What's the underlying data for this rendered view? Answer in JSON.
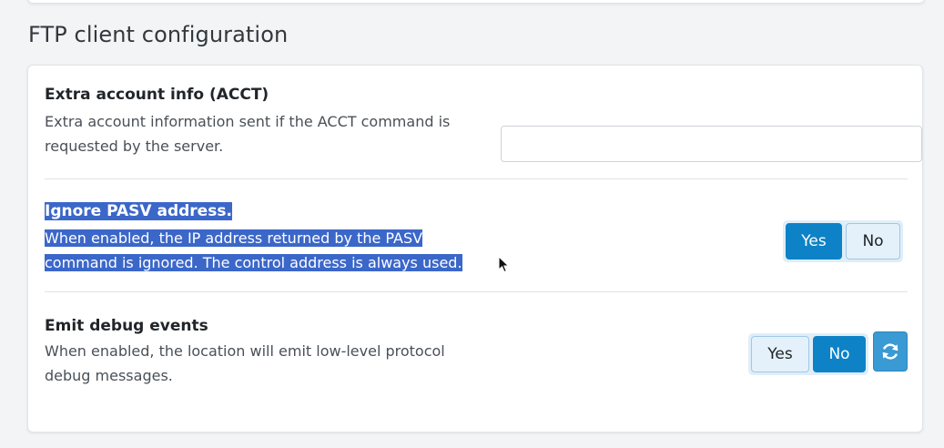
{
  "section": {
    "title": "FTP client configuration"
  },
  "settings": [
    {
      "label": "Extra account info (ACCT)",
      "description_lines": [
        "Extra account information sent if the ACCT command is",
        "requested by the server."
      ],
      "input_value": ""
    },
    {
      "label": "Ignore PASV address.",
      "description_lines": [
        "When enabled, the IP address returned by the PASV",
        "command is ignored. The control address is always used."
      ],
      "yes_label": "Yes",
      "no_label": "No",
      "selected": "Yes"
    },
    {
      "label": "Emit debug events",
      "description_lines": [
        "When enabled, the location will emit low-level protocol",
        "debug messages."
      ],
      "yes_label": "Yes",
      "no_label": "No",
      "selected": "No",
      "reset_icon": "refresh-icon"
    }
  ],
  "colors": {
    "active_button": "#0d82c7",
    "inactive_button": "#e4f1fa",
    "selection_highlight": "#3b67c9",
    "reset_button": "#3a9ad3"
  }
}
